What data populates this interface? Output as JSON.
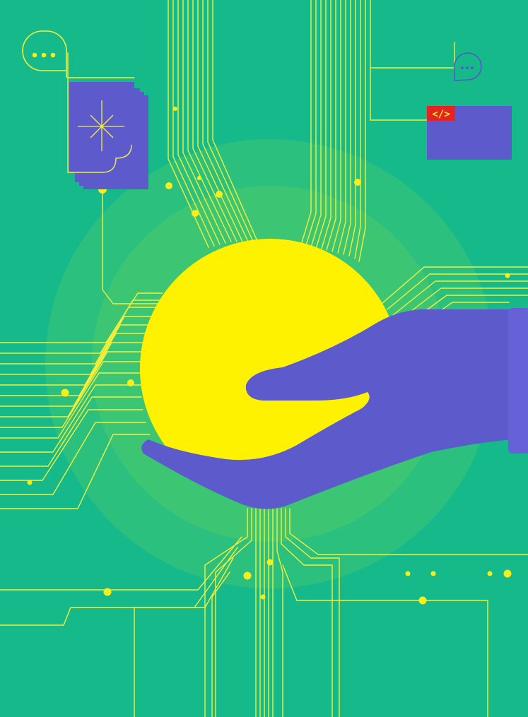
{
  "illustration": {
    "colors": {
      "background": "#16b98a",
      "glow_outer": "#2cc07e",
      "glow_inner": "#3cc673",
      "sun": "#fff200",
      "hand": "#5d5acb",
      "sleeve": "#6661d6",
      "trace": "#f4ef3a",
      "code_badge": "#e52320",
      "code_text": "#f6ec2c"
    },
    "code_badge": {
      "text": "</>"
    },
    "icons": [
      "chat-bubble-icon",
      "chat-bubble-icon",
      "sparkle-icon",
      "code-icon"
    ]
  }
}
